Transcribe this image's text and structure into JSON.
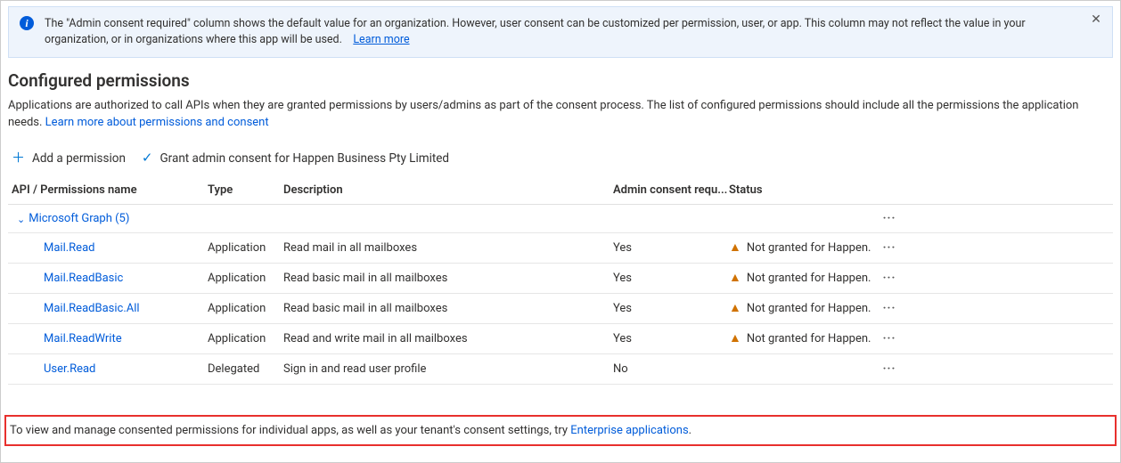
{
  "banner": {
    "text_a": "The \"Admin consent required\" column shows the default value for an organization. However, user consent can be customized per permission, user, or app. This column may not reflect the value in your organization, or in organizations where this app will be used.",
    "learn_more": "Learn more"
  },
  "section": {
    "title": "Configured permissions",
    "desc_a": "Applications are authorized to call APIs when they are granted permissions by users/admins as part of the consent process. The list of configured permissions should include all the permissions the application needs.",
    "desc_link": "Learn more about permissions and consent"
  },
  "commands": {
    "add": "Add a permission",
    "grant": "Grant admin consent for Happen Business Pty Limited"
  },
  "columns": {
    "api": "API / Permissions name",
    "type": "Type",
    "desc": "Description",
    "consent": "Admin consent requ...",
    "status": "Status"
  },
  "group": {
    "label": "Microsoft Graph (5)"
  },
  "rows": [
    {
      "name": "Mail.Read",
      "type": "Application",
      "desc": "Read mail in all mailboxes",
      "consent": "Yes",
      "status": "Not granted for Happen...",
      "warn": true
    },
    {
      "name": "Mail.ReadBasic",
      "type": "Application",
      "desc": "Read basic mail in all mailboxes",
      "consent": "Yes",
      "status": "Not granted for Happen...",
      "warn": true
    },
    {
      "name": "Mail.ReadBasic.All",
      "type": "Application",
      "desc": "Read basic mail in all mailboxes",
      "consent": "Yes",
      "status": "Not granted for Happen...",
      "warn": true
    },
    {
      "name": "Mail.ReadWrite",
      "type": "Application",
      "desc": "Read and write mail in all mailboxes",
      "consent": "Yes",
      "status": "Not granted for Happen...",
      "warn": true
    },
    {
      "name": "User.Read",
      "type": "Delegated",
      "desc": "Sign in and read user profile",
      "consent": "No",
      "status": "",
      "warn": false
    }
  ],
  "footer": {
    "text": "To view and manage consented permissions for individual apps, as well as your tenant's consent settings, try ",
    "link": "Enterprise applications",
    "tail": "."
  }
}
